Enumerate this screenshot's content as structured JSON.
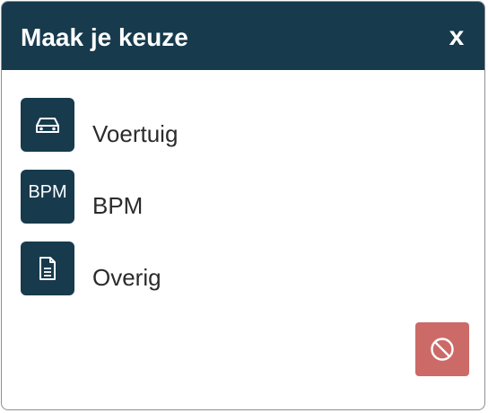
{
  "dialog": {
    "title": "Maak je keuze",
    "close_label": "x"
  },
  "options": [
    {
      "icon": "car-icon",
      "label": "Voertuig"
    },
    {
      "icon_text": "BPM",
      "label": "BPM"
    },
    {
      "icon": "document-icon",
      "label": "Overig"
    }
  ],
  "cancel": {
    "icon": "cancel-icon"
  },
  "colors": {
    "header": "#173a4d",
    "tile": "#173a4d",
    "cancel": "#cc6a67",
    "text": "#2b2b2b"
  }
}
